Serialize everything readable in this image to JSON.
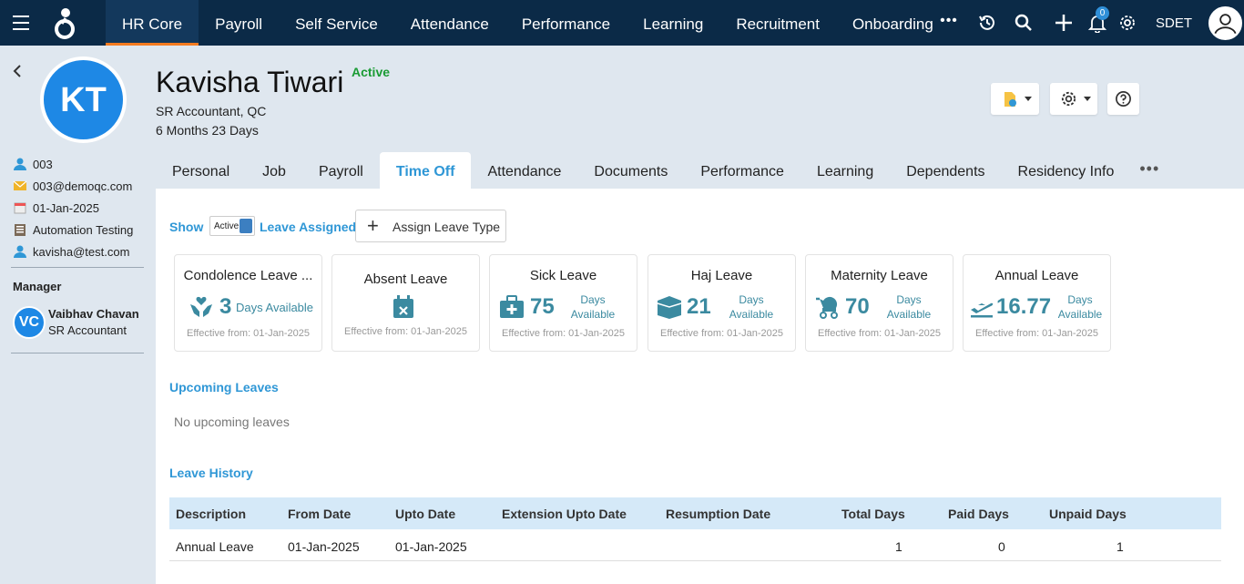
{
  "topnav": {
    "items": [
      "HR Core",
      "Payroll",
      "Self Service",
      "Attendance",
      "Performance",
      "Learning",
      "Recruitment",
      "Onboarding"
    ],
    "active": "HR Core",
    "notification_count": "0",
    "user_label": "SDET",
    "icons": [
      "menu-icon",
      "logo-icon",
      "more-icon",
      "history-icon",
      "search-icon",
      "plus-icon",
      "bell-icon",
      "gear-icon",
      "user-avatar-icon"
    ]
  },
  "profile": {
    "initials": "KT",
    "name": "Kavisha Tiwari",
    "status": "Active",
    "title": "SR Accountant, QC",
    "tenure": "6 Months 23 Days",
    "employee_id": "003",
    "email": "003@demoqc.com",
    "join_date": "01-Jan-2025",
    "department": "Automation Testing",
    "personal_email": "kavisha@test.com"
  },
  "manager": {
    "label": "Manager",
    "initials": "VC",
    "name": "Vaibhav Chavan",
    "role": "SR Accountant"
  },
  "tabs": [
    "Personal",
    "Job",
    "Payroll",
    "Time Off",
    "Attendance",
    "Documents",
    "Performance",
    "Learning",
    "Dependents",
    "Residency Info"
  ],
  "active_tab": "Time Off",
  "timeoff": {
    "show_label": "Show",
    "toggle_label": "Active",
    "leave_assigned_label": "Leave Assigned",
    "assign_button": "Assign Leave Type",
    "cards": [
      {
        "name": "Condolence Leave ...",
        "value": "3",
        "days": "Days Available",
        "effective": "Effective from: 01-Jan-2025",
        "icon": "hands-heart-icon"
      },
      {
        "name": "Absent Leave",
        "value": "",
        "days": "",
        "effective": "Effective from: 01-Jan-2025",
        "icon": "calendar-x-icon"
      },
      {
        "name": "Sick Leave",
        "value": "75",
        "days_line1": "Days",
        "days_line2": "Available",
        "effective": "Effective from: 01-Jan-2025",
        "icon": "medical-kit-icon"
      },
      {
        "name": "Haj Leave",
        "value": "21",
        "days_line1": "Days",
        "days_line2": "Available",
        "effective": "Effective from: 01-Jan-2025",
        "icon": "kaaba-icon"
      },
      {
        "name": "Maternity Leave",
        "value": "70",
        "days_line1": "Days",
        "days_line2": "Available",
        "effective": "Effective from: 01-Jan-2025",
        "icon": "baby-carriage-icon"
      },
      {
        "name": "Annual Leave",
        "value": "16.77",
        "days_line1": "Days",
        "days_line2": "Available",
        "effective": "Effective from: 01-Jan-2025",
        "icon": "plane-departure-icon"
      }
    ],
    "upcoming_title": "Upcoming Leaves",
    "no_upcoming": "No upcoming leaves",
    "history_title": "Leave History",
    "history_columns": [
      "Description",
      "From Date",
      "Upto Date",
      "Extension Upto Date",
      "Resumption Date",
      "Total Days",
      "Paid Days",
      "Unpaid Days"
    ],
    "history_rows": [
      {
        "description": "Annual Leave",
        "from": "01-Jan-2025",
        "upto": "01-Jan-2025",
        "extension": "",
        "resumption": "",
        "total": "1",
        "paid": "0",
        "unpaid": "1"
      }
    ]
  },
  "colors": {
    "nav_bg": "#0b2a47",
    "accent": "#2f97d6",
    "active_green": "#1a9b34",
    "card_teal": "#3b8aa0",
    "avatar_blue": "#1e88e5"
  }
}
